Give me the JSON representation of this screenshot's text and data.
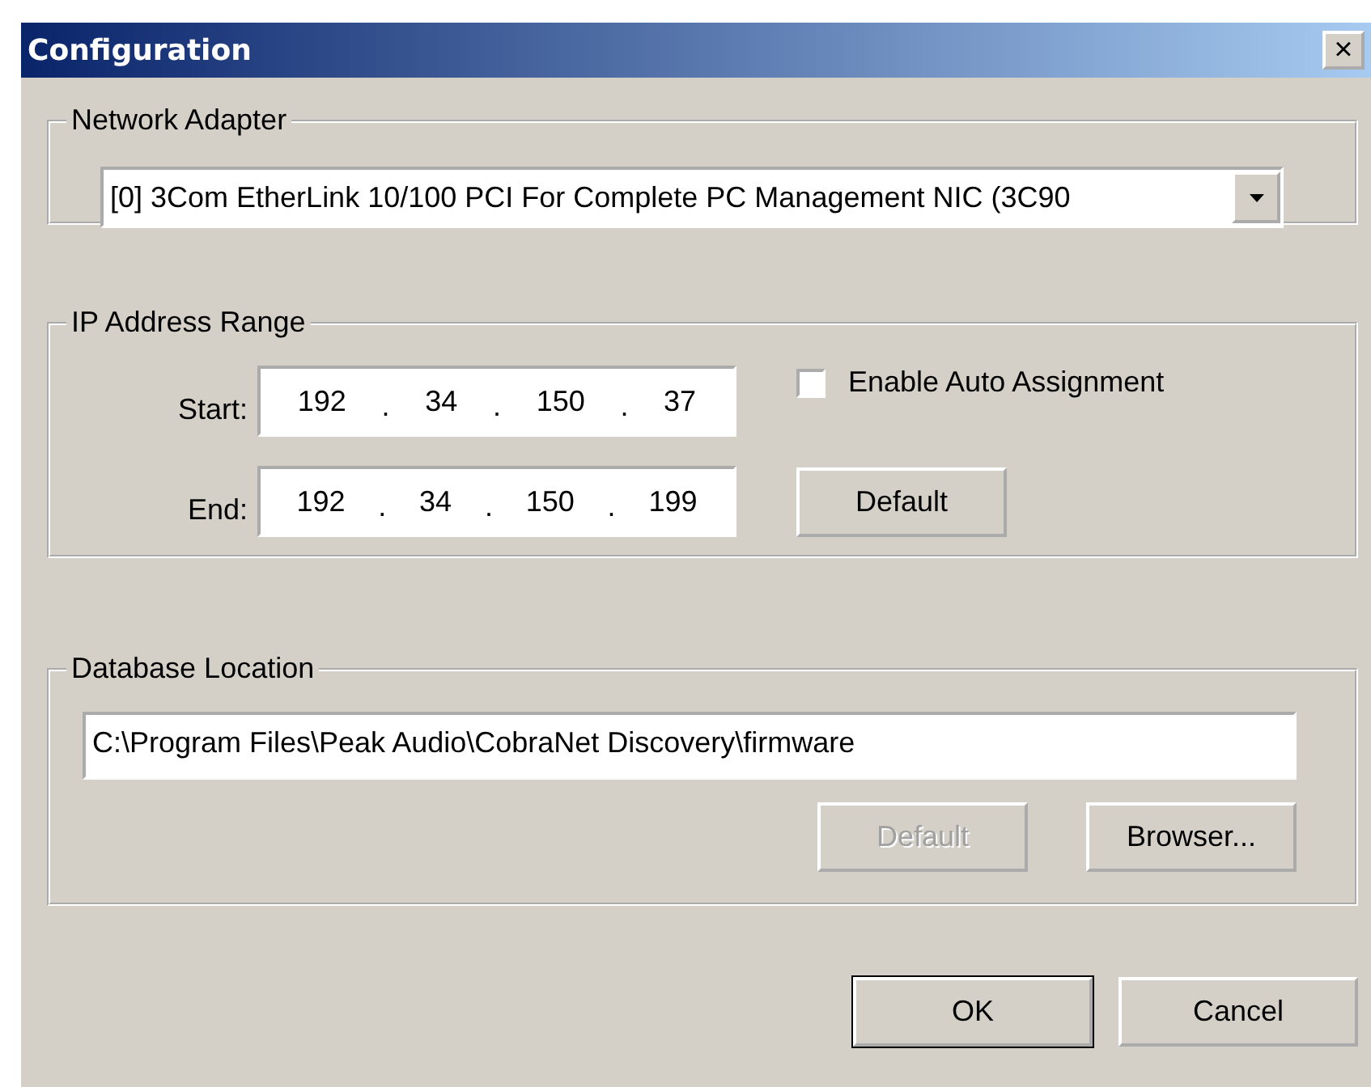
{
  "window": {
    "title": "Configuration",
    "close": "×"
  },
  "network_adapter": {
    "legend": "Network Adapter",
    "value": "[0] 3Com EtherLink 10/100 PCI For Complete PC Management NIC (3C90"
  },
  "ip_range": {
    "legend": "IP Address Range",
    "start": {
      "label": "Start:",
      "octets": [
        "192",
        "34",
        "150",
        "37"
      ],
      "separators": [
        ".",
        ".",
        "."
      ]
    },
    "end": {
      "label": "End:",
      "octets": [
        "192",
        "34",
        "150",
        "199"
      ],
      "separators": [
        ".",
        ".",
        "."
      ]
    },
    "auto_assign": {
      "label": "Enable Auto Assignment",
      "checked": false
    },
    "default_button": {
      "label": "Default",
      "disabled": false
    }
  },
  "database": {
    "legend": "Database Location",
    "path": "C:\\Program Files\\Peak Audio\\CobraNet Discovery\\firmware",
    "buttons": [
      {
        "label": "Default",
        "disabled": true
      },
      {
        "label": "Browser...",
        "disabled": false
      }
    ]
  },
  "buttons": [
    {
      "label": "OK",
      "default": true
    },
    {
      "label": "Cancel",
      "default": false
    }
  ]
}
